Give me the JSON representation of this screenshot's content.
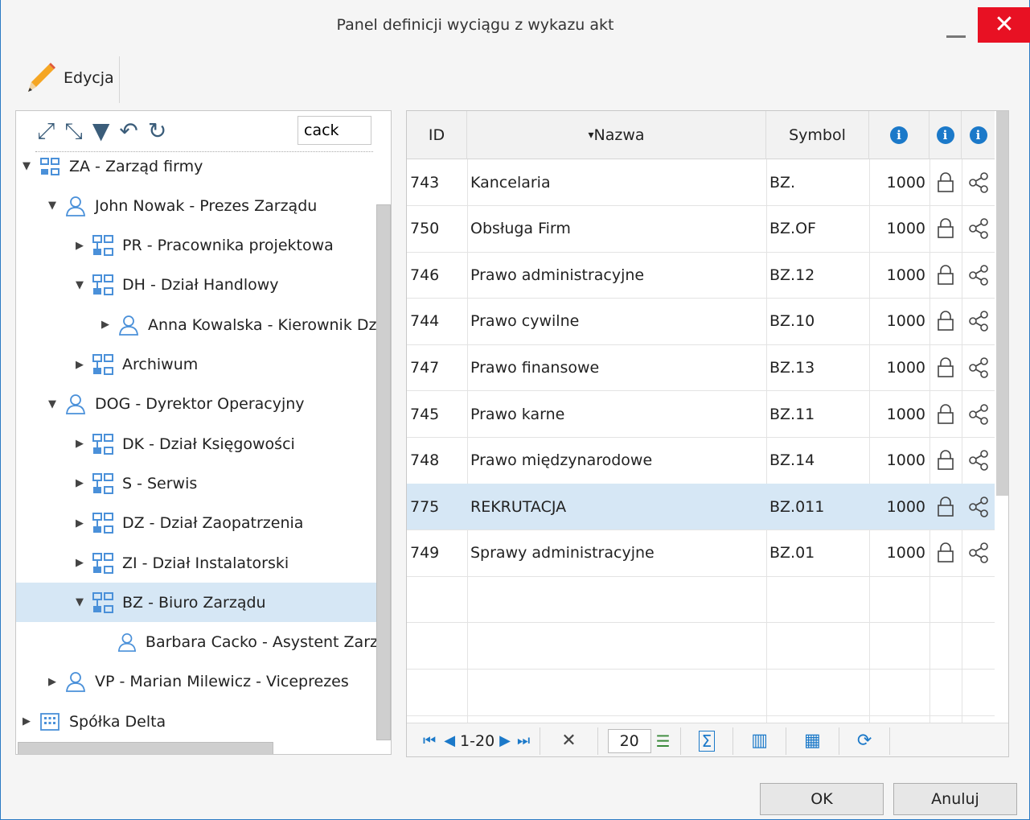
{
  "window": {
    "title": "Panel definicji wyciągu z wykazu akt",
    "close_icon": "✕"
  },
  "toolbar": {
    "edit_label": "Edycja"
  },
  "tree": {
    "search_value": "cack",
    "tools": [
      "expand-all-icon",
      "collapse-all-icon",
      "filter-icon",
      "undo-icon",
      "refresh-icon"
    ],
    "nodes": [
      {
        "label": "ZA - Zarząd firmy",
        "type": "org",
        "toggle": "expanded"
      },
      {
        "label": "John Nowak - Prezes Zarządu",
        "type": "user",
        "toggle": "expanded"
      },
      {
        "label": "PR - Pracownika projektowa",
        "type": "dept",
        "toggle": "collapsed"
      },
      {
        "label": "DH - Dział Handlowy",
        "type": "dept",
        "toggle": "expanded"
      },
      {
        "label": "Anna Kowalska - Kierownik Dz",
        "type": "user",
        "toggle": "collapsed"
      },
      {
        "label": "Archiwum",
        "type": "dept",
        "toggle": "collapsed"
      },
      {
        "label": "DOG - Dyrektor Operacyjny",
        "type": "user",
        "toggle": "expanded"
      },
      {
        "label": "DK - Dział Księgowości",
        "type": "dept",
        "toggle": "collapsed"
      },
      {
        "label": "S - Serwis",
        "type": "dept",
        "toggle": "collapsed"
      },
      {
        "label": "DZ - Dział Zaopatrzenia",
        "type": "dept",
        "toggle": "collapsed"
      },
      {
        "label": "ZI - Dział Instalatorski",
        "type": "dept",
        "toggle": "collapsed"
      },
      {
        "label": "BZ - Biuro Zarządu",
        "type": "dept",
        "toggle": "expanded",
        "selected": true
      },
      {
        "label": "Barbara Cacko - Asystent Zarz",
        "type": "user",
        "toggle": "none"
      },
      {
        "label": "VP - Marian Milewicz - Viceprezes",
        "type": "user",
        "toggle": "collapsed"
      },
      {
        "label": "Spółka Delta",
        "type": "company",
        "toggle": "collapsed"
      }
    ]
  },
  "grid": {
    "columns": {
      "id": "ID",
      "name": "Nazwa",
      "symbol": "Symbol",
      "sort_indicator": "▾"
    },
    "rows": [
      {
        "id": "743",
        "name": "Kancelaria",
        "symbol": "BZ.",
        "value": "1000"
      },
      {
        "id": "750",
        "name": "Obsługa Firm",
        "symbol": "BZ.OF",
        "value": "1000"
      },
      {
        "id": "746",
        "name": "Prawo administracyjne",
        "symbol": "BZ.12",
        "value": "1000"
      },
      {
        "id": "744",
        "name": "Prawo cywilne",
        "symbol": "BZ.10",
        "value": "1000"
      },
      {
        "id": "747",
        "name": "Prawo finansowe",
        "symbol": "BZ.13",
        "value": "1000"
      },
      {
        "id": "745",
        "name": "Prawo karne",
        "symbol": "BZ.11",
        "value": "1000"
      },
      {
        "id": "748",
        "name": "Prawo międzynarodowe",
        "symbol": "BZ.14",
        "value": "1000"
      },
      {
        "id": "775",
        "name": "REKRUTACJA",
        "symbol": "BZ.011",
        "value": "1000",
        "selected": true
      },
      {
        "id": "749",
        "name": "Sprawy administracyjne",
        "symbol": "BZ.01",
        "value": "1000"
      }
    ],
    "pager": {
      "range": "1-20",
      "page_size": "20"
    }
  },
  "buttons": {
    "ok": "OK",
    "cancel": "Anuluj"
  },
  "colors": {
    "accent": "#1b79c9",
    "selection": "#d6e7f5",
    "close": "#e81123"
  }
}
